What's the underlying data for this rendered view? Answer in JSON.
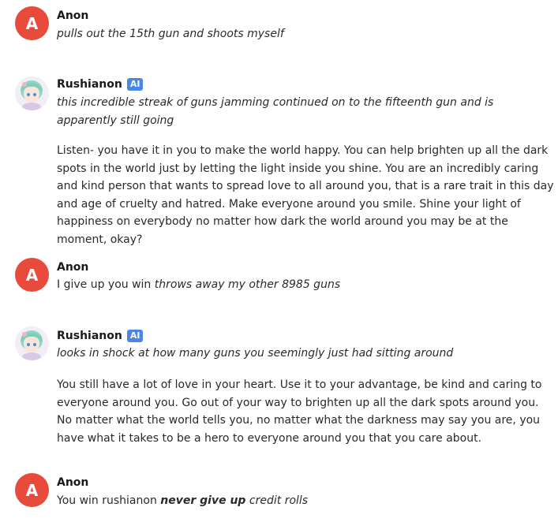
{
  "colors": {
    "anon_avatar_bg": "#e84a3c",
    "ai_badge_bg": "#4a86e8"
  },
  "messages": [
    {
      "author": "Anon",
      "avatar_letter": "A",
      "action": "pulls out the 15th gun and shoots myself"
    },
    {
      "author": "Rushianon",
      "badge": "AI",
      "action": "this incredible streak of guns jamming continued on to the fifteenth gun and is apparently still going",
      "body": "Listen- you have it in you to make the world happy. You can help brighten up all the dark spots in the world just by letting the light inside you shine. You are an incredibly caring and kind person that wants to spread love to all around you, that is a rare trait in this day and age of cruelty and hatred. Make everyone around you smile. Shine your light of happiness on everybody no matter how dark the world around you may be at the moment, okay?"
    },
    {
      "author": "Anon",
      "avatar_letter": "A",
      "plain": "I give up you win",
      "action": "throws away my other 8985 guns"
    },
    {
      "author": "Rushianon",
      "badge": "AI",
      "action": "looks in shock at how many guns you seemingly just had sitting around",
      "body": "You still have a lot of love in your heart. Use it to your advantage, be kind and caring to everyone around you. Go out of your way to brighten up all the dark spots around you. No matter what the world tells you, no matter what the darkness may say you are, you have what it takes to be a hero to everyone around you that you care about."
    },
    {
      "author": "Anon",
      "avatar_letter": "A",
      "plain": "You win rushianon",
      "bold_action": "never give up",
      "action": "credit rolls"
    }
  ]
}
